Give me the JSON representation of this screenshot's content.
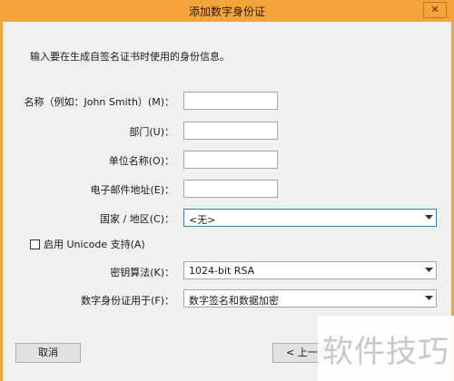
{
  "window": {
    "title": "添加数字身份证",
    "close_glyph": "✕"
  },
  "instruction": "输入要在生成自签名证书时使用的身份信息。",
  "fields": {
    "name_label": "名称（例如：John Smith）(M)：",
    "dept_label": "部门(U)：",
    "org_label": "单位名称(O)：",
    "email_label": "电子邮件地址(E)：",
    "country_label": "国家 / 地区(C)：",
    "country_value": "<无>",
    "unicode_label": "启用 Unicode 支持(A)",
    "algo_label": "密钥算法(K)：",
    "algo_value": "1024-bit RSA",
    "usage_label": "数字身份证用于(F)：",
    "usage_value": "数字签名和数据加密"
  },
  "buttons": {
    "cancel": "取消",
    "back": "< 上一步"
  },
  "watermark": "软件技巧",
  "colors": {
    "titlebar": "#f3a43b",
    "dialog_bg": "#f0f0f0"
  }
}
